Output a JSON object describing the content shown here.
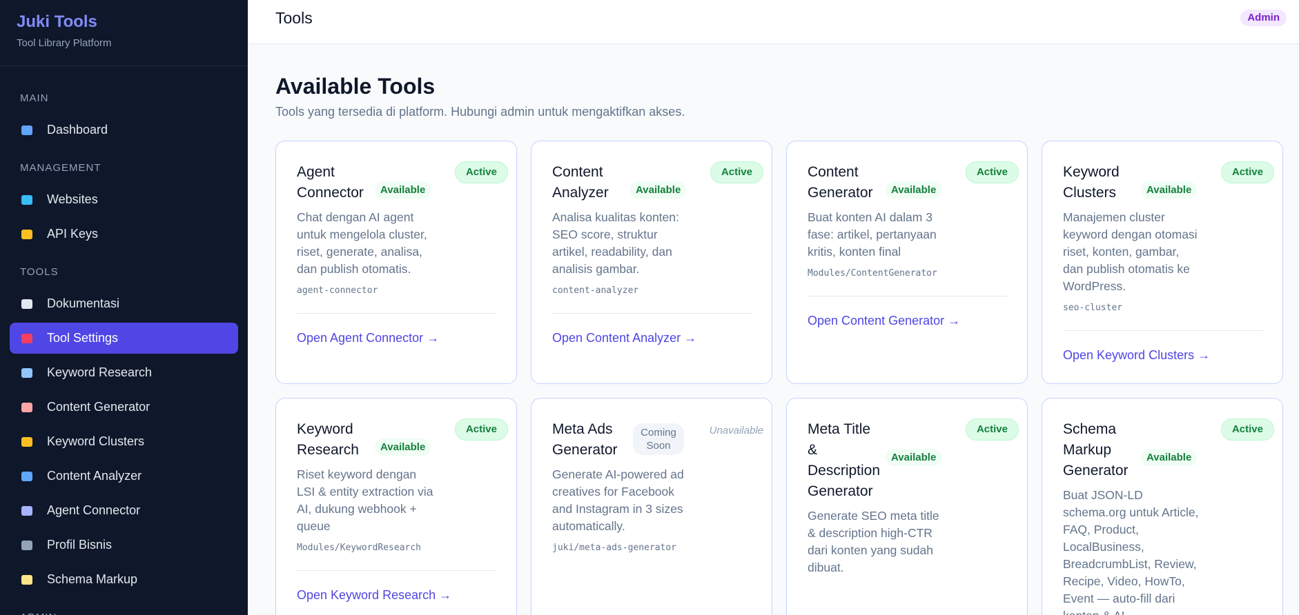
{
  "sidebar": {
    "brand": "Juki Tools",
    "subtitle": "Tool Library Platform",
    "sections": [
      {
        "label": "MAIN",
        "items": [
          {
            "label": "Dashboard",
            "icon": "bar-chart-icon",
            "color": "#60a5fa"
          }
        ]
      },
      {
        "label": "MANAGEMENT",
        "items": [
          {
            "label": "Websites",
            "icon": "globe-icon",
            "color": "#38bdf8"
          },
          {
            "label": "API Keys",
            "icon": "key-icon",
            "color": "#fbbf24"
          }
        ]
      },
      {
        "label": "TOOLS",
        "items": [
          {
            "label": "Dokumentasi",
            "icon": "book-icon",
            "color": "#e2e8f0"
          },
          {
            "label": "Tool Settings",
            "icon": "toolbox-icon",
            "color": "#f43f5e",
            "active": true
          },
          {
            "label": "Keyword Research",
            "icon": "magnifier-icon",
            "color": "#93c5fd"
          },
          {
            "label": "Content Generator",
            "icon": "memo-icon",
            "color": "#fca5a5"
          },
          {
            "label": "Keyword Clusters",
            "icon": "folder-icon",
            "color": "#fbbf24"
          },
          {
            "label": "Content Analyzer",
            "icon": "bar-chart-icon",
            "color": "#60a5fa"
          },
          {
            "label": "Agent Connector",
            "icon": "robot-icon",
            "color": "#a5b4fc"
          },
          {
            "label": "Profil Bisnis",
            "icon": "office-building-icon",
            "color": "#94a3b8"
          },
          {
            "label": "Schema Markup",
            "icon": "clipboard-icon",
            "color": "#fde68a"
          }
        ]
      },
      {
        "label": "ADMIN",
        "items": []
      }
    ]
  },
  "topbar": {
    "title": "Tools",
    "badge": "Admin"
  },
  "main": {
    "title": "Available Tools",
    "description": "Tools yang tersedia di platform. Hubungi admin untuk mengaktifkan akses.",
    "cards": [
      {
        "title": "Agent Connector",
        "availability": "Available",
        "status": "Active",
        "desc": "Chat dengan AI agent untuk mengelola cluster, riset, generate, analisa, dan publish otomatis.",
        "slug": "agent-connector",
        "link": "Open Agent Connector →"
      },
      {
        "title": "Content Analyzer",
        "availability": "Available",
        "status": "Active",
        "desc": "Analisa kualitas konten: SEO score, struktur artikel, readability, dan analisis gambar.",
        "slug": "content-analyzer",
        "link": "Open Content Analyzer →"
      },
      {
        "title": "Content Generator",
        "availability": "Available",
        "status": "Active",
        "desc": "Buat konten AI dalam 3 fase: artikel, pertanyaan kritis, konten final",
        "slug": "Modules/ContentGenerator",
        "link": "Open Content Generator →"
      },
      {
        "title": "Keyword Clusters",
        "availability": "Available",
        "status": "Active",
        "desc": "Manajemen cluster keyword dengan otomasi riset, konten, gambar, dan publish otomatis ke WordPress.",
        "slug": "seo-cluster",
        "link": "Open Keyword Clusters →"
      },
      {
        "title": "Keyword Research",
        "availability": "Available",
        "status": "Active",
        "desc": "Riset keyword dengan LSI & entity extraction via AI, dukung webhook + queue",
        "slug": "Modules/KeywordResearch",
        "link": "Open Keyword Research →"
      },
      {
        "title": "Meta Ads Generator",
        "availability": "Coming Soon",
        "status": "Unavailable",
        "desc": "Generate AI-powered ad creatives for Facebook and Instagram in 3 sizes automatically.",
        "slug": "juki/meta-ads-generator",
        "link": ""
      },
      {
        "title": "Meta Title & Description Generator",
        "availability": "Available",
        "status": "Active",
        "desc": "Generate SEO meta title & description high-CTR dari konten yang sudah dibuat.",
        "slug": "",
        "link": ""
      },
      {
        "title": "Schema Markup Generator",
        "availability": "Available",
        "status": "Active",
        "desc": "Buat JSON-LD schema.org untuk Article, FAQ, Product, LocalBusiness, BreadcrumbList, Review, Recipe, Video, HowTo, Event — auto-fill dari konten & AI",
        "slug": "",
        "link": ""
      }
    ]
  }
}
